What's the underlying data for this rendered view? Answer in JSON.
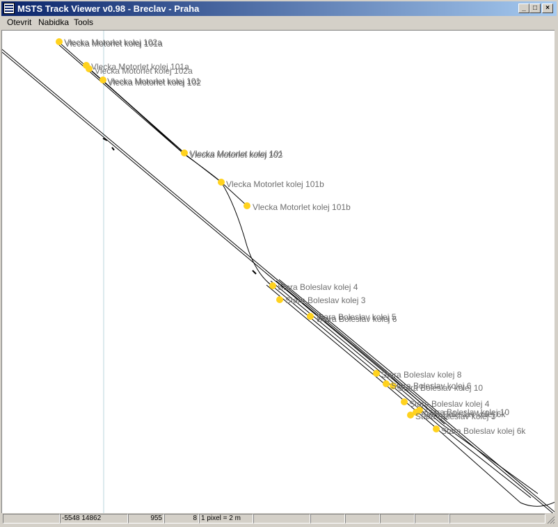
{
  "window": {
    "title": "MSTS Track Viewer v0.98 - Breclav - Praha",
    "buttons": {
      "minimize": "_",
      "maximize": "□",
      "close": "×"
    }
  },
  "menu": [
    "Otevrit",
    "Nabidka",
    "Tools"
  ],
  "map": {
    "labels": [
      "Vlecka Motorlet kolej 101a",
      "Vlecka Motorlet kolej 102a",
      "Vlecka Motorlet kolej 101a",
      "Vlecka Motorlet kolej 102a",
      "Vlecka Motorlet kolej 102",
      "Vlecka Motorlet kolej 101",
      "Vlecka Motorlet kolej 101",
      "Vlecka Motorlet kolej 102",
      "Vlecka Motorlet kolej 101b",
      "Vlecka Motorlet kolej 101b",
      "Stara Boleslav kolej 4",
      "Stara Boleslav kolej 3",
      "Stara Boleslav kolej 5",
      "Stara Boleslav kolej 6",
      "Stara Boleslav kolej 8",
      "Stara Boleslav kolej 6",
      "Stara Boleslav kolej 10",
      "Stara Boleslav kolej 4",
      "Stara Boleslav kolej 10",
      "Stara Boleslav kolej 6k",
      "Stara Boleslav kolej 3",
      "Stara Boleslav kolej 6k"
    ],
    "marker_color": "#ffd21e",
    "track_color": "#000000",
    "grid_line_color": "#b8d4dc"
  },
  "status": {
    "coords": "-5548 14862",
    "value1": "955",
    "value2": "8",
    "scale": "1 pixel = 2 m",
    "empty1": "",
    "empty2": "",
    "empty3": "",
    "empty4": ""
  }
}
